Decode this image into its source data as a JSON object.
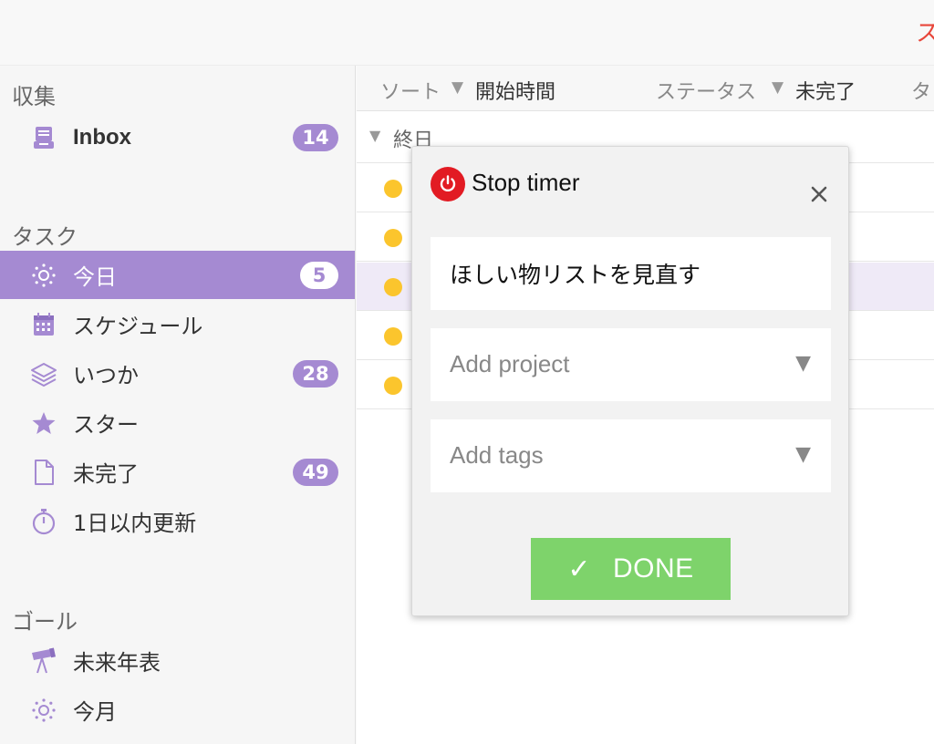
{
  "topbar": {
    "partial_text": "ス"
  },
  "sidebar": {
    "section_collect": "収集",
    "section_tasks": "タスク",
    "section_goals": "ゴール",
    "inbox": {
      "label": "Inbox",
      "count": "14",
      "icon": "inbox-icon"
    },
    "tasks": [
      {
        "label": "今日",
        "count": "5",
        "icon": "sun-icon",
        "active": true
      },
      {
        "label": "スケジュール",
        "count": "",
        "icon": "calendar-icon"
      },
      {
        "label": "いつか",
        "count": "28",
        "icon": "layers-icon"
      },
      {
        "label": "スター",
        "count": "",
        "icon": "star-icon"
      },
      {
        "label": "未完了",
        "count": "49",
        "icon": "document-icon"
      },
      {
        "label": "1日以内更新",
        "count": "",
        "icon": "stopwatch-icon"
      }
    ],
    "goals": [
      {
        "label": "未来年表",
        "icon": "telescope-icon"
      },
      {
        "label": "今月",
        "icon": "sun-icon"
      }
    ]
  },
  "main": {
    "sort": {
      "sort_label": "ソート",
      "sort_value": "開始時間",
      "status_label": "ステータス",
      "status_value": "未完了",
      "extra_label": "タ"
    },
    "group_header": "終日",
    "task_dot_color": "#fbc52d"
  },
  "popup": {
    "title": "Stop timer",
    "task_name": "ほしい物リストを見直す",
    "project_placeholder": "Add project",
    "tags_placeholder": "Add tags",
    "done_label": "DONE",
    "power_color": "#e21b23",
    "done_color": "#7ed36b"
  },
  "colors": {
    "accent": "#a58ad2",
    "selected_row": "#efeaf7"
  }
}
